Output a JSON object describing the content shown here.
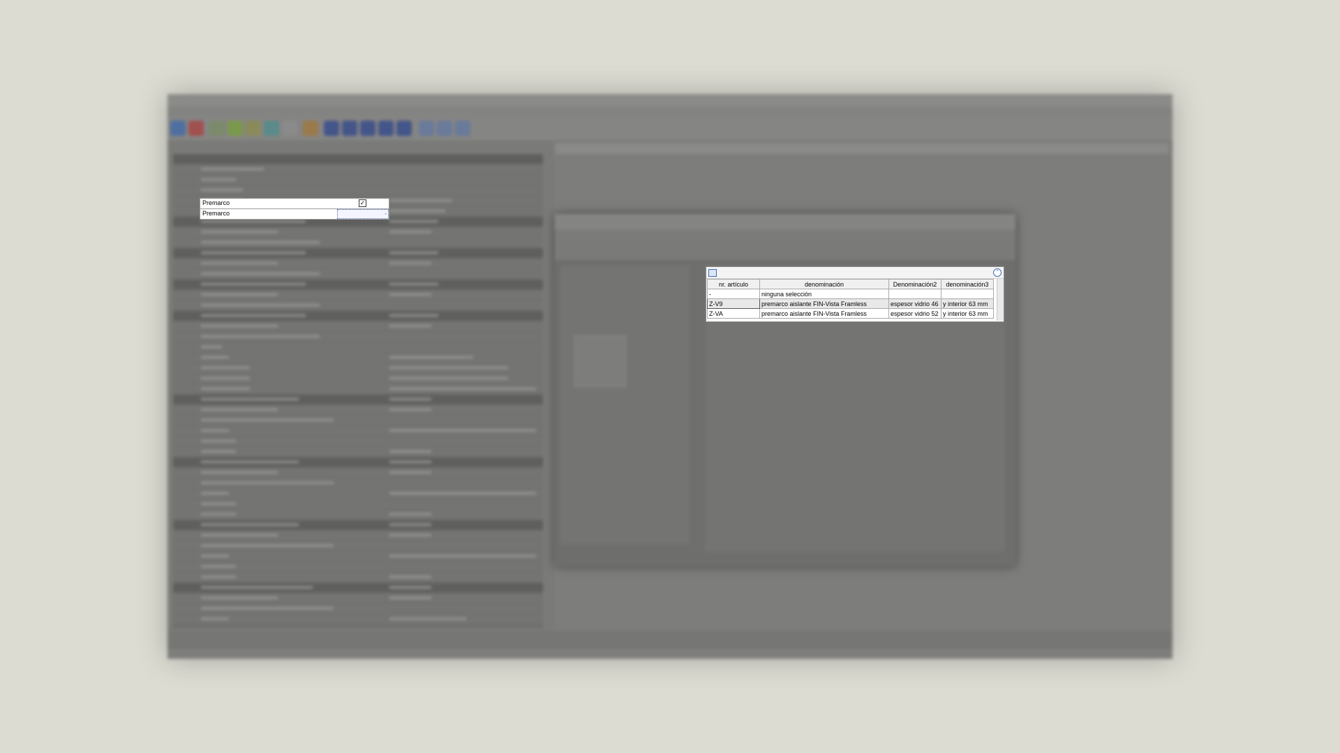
{
  "premarco_rows": [
    {
      "label": "Premarco",
      "checked": true
    },
    {
      "label": "Premarco",
      "value": "-"
    }
  ],
  "grid": {
    "headers": [
      "nr. artículo",
      "denominación",
      "Denominación2",
      "denominación3"
    ],
    "rows": [
      {
        "nr": "-",
        "den": "ninguna selección",
        "den2": "",
        "den3": ""
      },
      {
        "nr": "Z-V9",
        "den": "premarco aislante FIN-Vista Framless",
        "den2": "espesor vidrio 46",
        "den3": "y interior 63 mm"
      },
      {
        "nr": "Z-VA",
        "den": "premarco aislante FIN-Vista Framless",
        "den2": "espesor vidrio 52",
        "den3": "y interior 63 mm"
      }
    ]
  },
  "colors": {
    "desktop": "#dcdcd3",
    "window": "#7a7a78",
    "preview_glass": "#2e8b86",
    "grid_accent": "#3a6ab0"
  },
  "icons": [
    "grid-view-icon",
    "collapse-icon",
    "checkbox-checked-icon",
    "dropdown-arrow-icon"
  ]
}
